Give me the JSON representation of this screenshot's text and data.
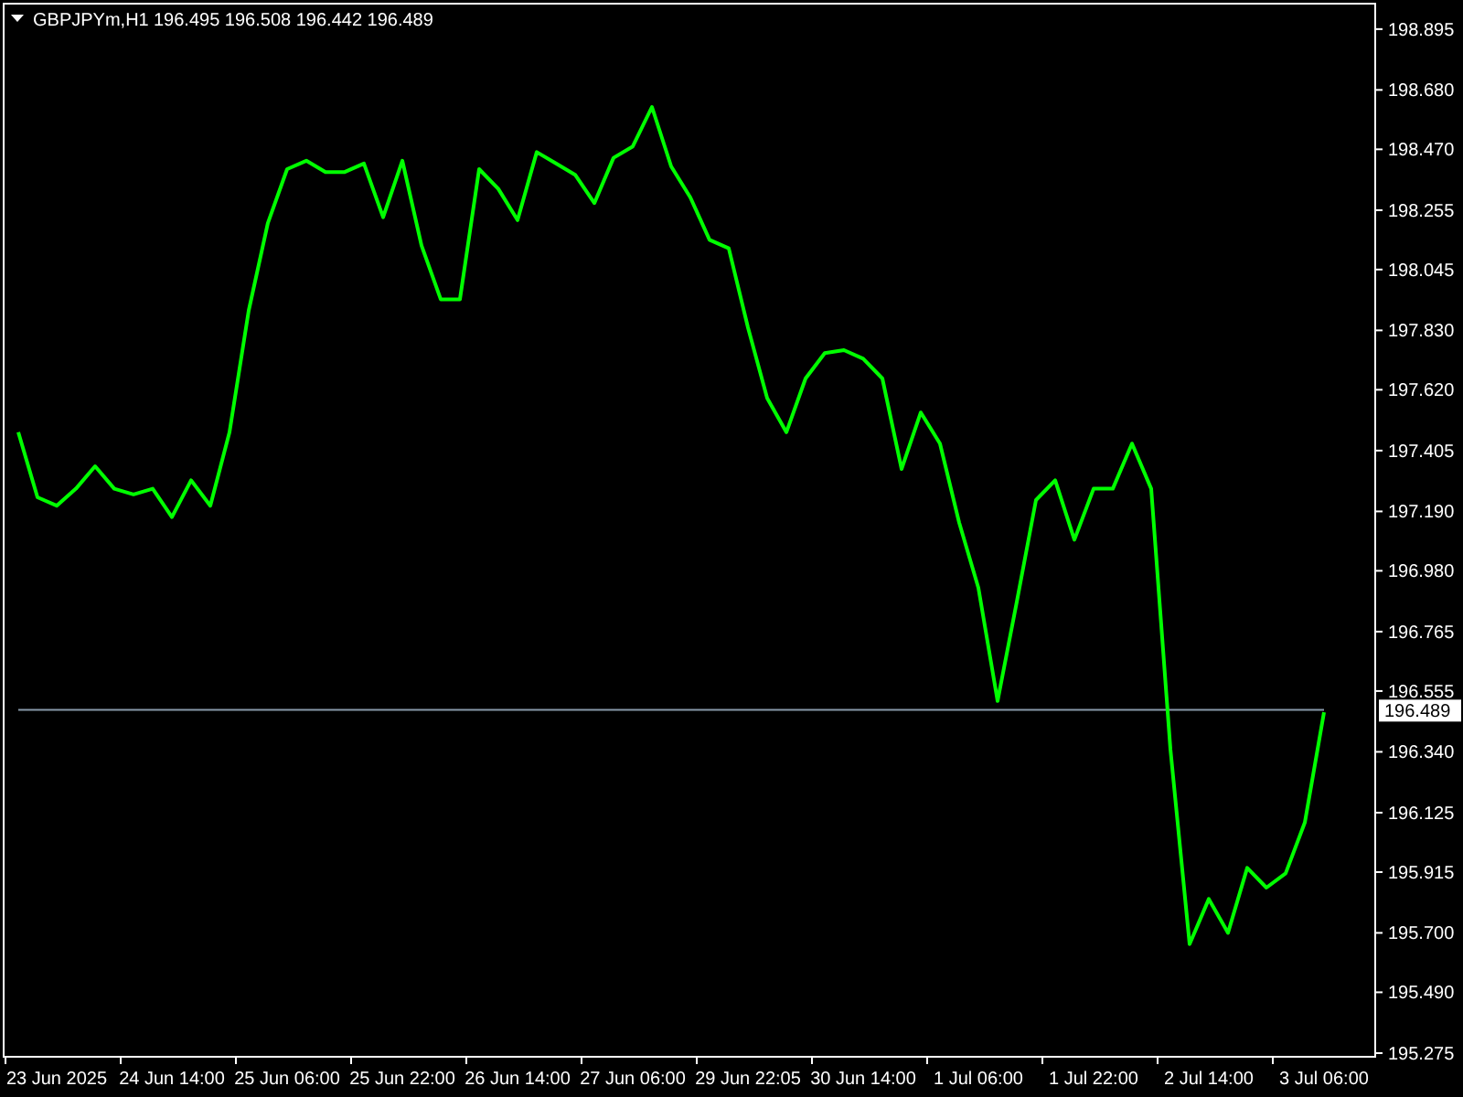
{
  "header": {
    "symbol": "GBPJPYm,H1",
    "quotes": "196.495 196.508 196.442 196.489"
  },
  "current_price": "196.489",
  "chart_data": {
    "type": "line",
    "ylim": [
      195.262,
      198.985
    ],
    "categories": [
      null,
      null,
      "23 Jun 2025",
      null,
      null,
      null,
      null,
      null,
      "24 Jun 14:00",
      null,
      null,
      null,
      null,
      null,
      "25 Jun 06:00",
      null,
      null,
      null,
      null,
      null,
      "25 Jun 22:00",
      null,
      null,
      null,
      null,
      null,
      "26 Jun 14:00",
      null,
      null,
      null,
      null,
      null,
      "27 Jun 06:00",
      null,
      null,
      null,
      null,
      null,
      "29 Jun 22:05",
      null,
      null,
      null,
      null,
      null,
      "30 Jun 14:00",
      null,
      null,
      null,
      null,
      null,
      "1 Jul 06:00",
      null,
      null,
      null,
      null,
      null,
      "1 Jul 22:00",
      null,
      null,
      null,
      null,
      null,
      "2 Jul 14:00",
      null,
      null,
      null,
      null,
      null,
      "3 Jul 06:00"
    ],
    "series": [
      {
        "color": "#00ff00",
        "values": [
          197.47,
          197.24,
          197.21,
          197.27,
          197.35,
          197.27,
          197.25,
          197.27,
          197.17,
          197.3,
          197.21,
          197.47,
          197.9,
          198.21,
          198.4,
          198.43,
          198.39,
          198.39,
          198.42,
          198.23,
          198.43,
          198.13,
          197.94,
          197.94,
          198.4,
          198.33,
          198.22,
          198.46,
          198.42,
          198.38,
          198.28,
          198.44,
          198.48,
          198.62,
          198.41,
          198.3,
          198.15,
          198.12,
          197.84,
          197.59,
          197.47,
          197.66,
          197.75,
          197.76,
          197.73,
          197.66,
          197.34,
          197.54,
          197.43,
          197.15,
          196.92,
          196.52,
          196.87,
          197.23,
          197.3,
          197.09,
          197.27,
          197.27,
          197.43,
          197.27,
          196.35,
          195.66,
          195.82,
          195.7,
          195.93,
          195.86,
          195.91,
          196.09,
          196.48
        ]
      },
      {
        "color": "#8899aa",
        "values": [
          196.489,
          196.489,
          196.489,
          196.489,
          196.489,
          196.489,
          196.489,
          196.489,
          196.489,
          196.489,
          196.489,
          196.489,
          196.489,
          196.489,
          196.489,
          196.489,
          196.489,
          196.489,
          196.489,
          196.489,
          196.489,
          196.489,
          196.489,
          196.489,
          196.489,
          196.489,
          196.489,
          196.489,
          196.489,
          196.489,
          196.489,
          196.489,
          196.489,
          196.489,
          196.489,
          196.489,
          196.489,
          196.489,
          196.489,
          196.489,
          196.489,
          196.489,
          196.489,
          196.489,
          196.489,
          196.489,
          196.489,
          196.489,
          196.489,
          196.489,
          196.489,
          196.489,
          196.489,
          196.489,
          196.489,
          196.489,
          196.489,
          196.489,
          196.489,
          196.489,
          196.489,
          196.489,
          196.489,
          196.489,
          196.489,
          196.489,
          196.489,
          196.489,
          196.489
        ]
      }
    ],
    "yticks": [
      {
        "value": 198.895,
        "label": "198.895"
      },
      {
        "value": 198.68,
        "label": "198.680"
      },
      {
        "value": 198.47,
        "label": "198.470"
      },
      {
        "value": 198.255,
        "label": "198.255"
      },
      {
        "value": 198.045,
        "label": "198.045"
      },
      {
        "value": 197.83,
        "label": "197.830"
      },
      {
        "value": 197.62,
        "label": "197.620"
      },
      {
        "value": 197.405,
        "label": "197.405"
      },
      {
        "value": 197.19,
        "label": "197.190"
      },
      {
        "value": 196.98,
        "label": "196.980"
      },
      {
        "value": 196.765,
        "label": "196.765"
      },
      {
        "value": 196.555,
        "label": "196.555"
      },
      {
        "value": 196.34,
        "label": "196.340"
      },
      {
        "value": 196.125,
        "label": "196.125"
      },
      {
        "value": 195.915,
        "label": "195.915"
      },
      {
        "value": 195.7,
        "label": "195.700"
      },
      {
        "value": 195.49,
        "label": "195.490"
      },
      {
        "value": 195.275,
        "label": "195.275"
      }
    ]
  }
}
